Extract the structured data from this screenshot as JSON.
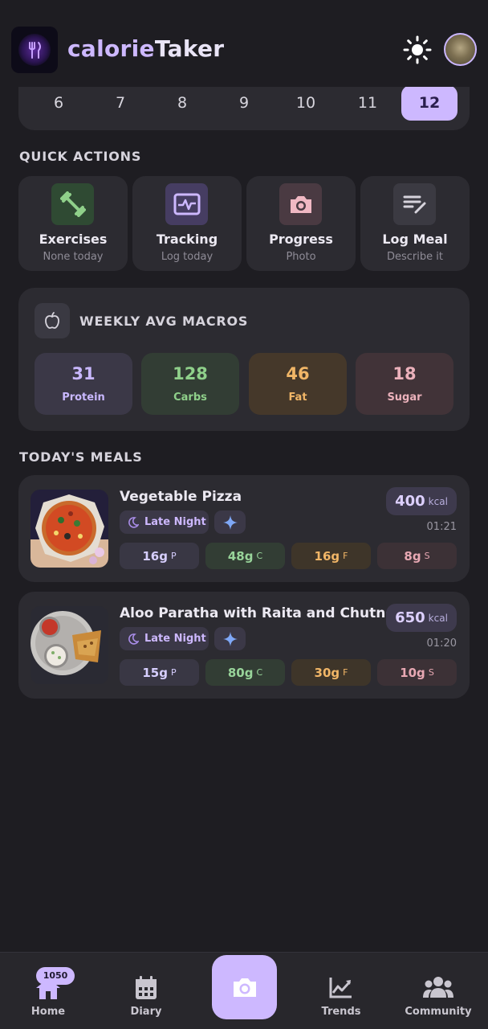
{
  "header": {
    "title_part1": "calorie",
    "title_part2": "Taker",
    "theme_icon": "sun-icon",
    "avatar_icon": "avatar"
  },
  "calendar": {
    "days": [
      "6",
      "7",
      "8",
      "9",
      "10",
      "11",
      "12"
    ],
    "selected": "12"
  },
  "quick_actions": {
    "label": "QUICK ACTIONS",
    "items": [
      {
        "title": "Exercises",
        "sub": "None today",
        "icon": "dumbbell-icon",
        "color": "#8fd08a"
      },
      {
        "title": "Tracking",
        "sub": "Log today",
        "icon": "pulse-icon",
        "color": "#cdb8ff"
      },
      {
        "title": "Progress",
        "sub": "Photo",
        "icon": "camera-icon",
        "color": "#f0b8c3"
      },
      {
        "title": "Log Meal",
        "sub": "Describe it",
        "icon": "edit-note-icon",
        "color": "#d6d3dc"
      }
    ]
  },
  "macros": {
    "label": "WEEKLY AVG MACROS",
    "icon": "apple-icon",
    "items": [
      {
        "value": "31",
        "label": "Protein",
        "color": "#c9b8ff"
      },
      {
        "value": "128",
        "label": "Carbs",
        "color": "#8fd08a"
      },
      {
        "value": "46",
        "label": "Fat",
        "color": "#f1b667"
      },
      {
        "value": "18",
        "label": "Sugar",
        "color": "#ebb1bb"
      }
    ]
  },
  "meals": {
    "label": "TODAY'S MEALS",
    "items": [
      {
        "name": "Vegetable Pizza",
        "tag": "Late Night",
        "kcal": "400",
        "unit": "kcal",
        "time": "01:21",
        "protein": "16g",
        "carbs": "48g",
        "fat": "16g",
        "sugar": "8g"
      },
      {
        "name": "Aloo Paratha with Raita and Chutneys",
        "tag": "Late Night",
        "kcal": "650",
        "unit": "kcal",
        "time": "01:20",
        "protein": "15g",
        "carbs": "80g",
        "fat": "30g",
        "sugar": "10g"
      }
    ],
    "unit_letters": {
      "protein": "P",
      "carbs": "C",
      "fat": "F",
      "sugar": "S"
    }
  },
  "nav": {
    "badge": "1050",
    "items": [
      {
        "label": "Home",
        "icon": "home-icon"
      },
      {
        "label": "Diary",
        "icon": "calendar-icon"
      },
      {
        "label": "Trends",
        "icon": "trending-up-icon"
      },
      {
        "label": "Community",
        "icon": "people-icon"
      }
    ]
  }
}
